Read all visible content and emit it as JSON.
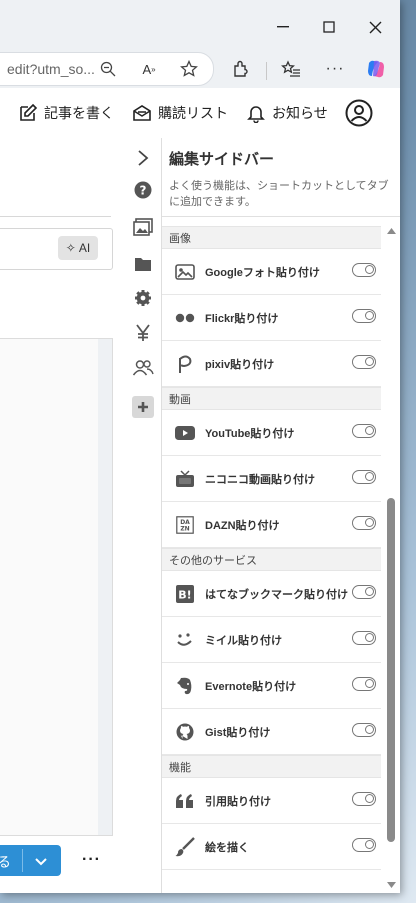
{
  "browser": {
    "address_text": "edit?utm_so...",
    "minimize": "—",
    "maximize": "☐",
    "close": "✕"
  },
  "toolbar": {
    "write_label": "記事を書く",
    "reading_label": "購読リスト",
    "notify_label": "お知らせ"
  },
  "editor": {
    "ai_label": "AI",
    "publish_fragment": "る"
  },
  "sidebar": {
    "title": "編集サイドバー",
    "description": "よく使う機能は、ショートカットとしてタブに追加できます。",
    "sections": [
      {
        "name": "画像",
        "items": [
          {
            "label": "Googleフォト貼り付け",
            "icon": "google-photos-icon"
          },
          {
            "label": "Flickr貼り付け",
            "icon": "flickr-icon"
          },
          {
            "label": "pixiv貼り付け",
            "icon": "pixiv-icon"
          }
        ]
      },
      {
        "name": "動画",
        "items": [
          {
            "label": "YouTube貼り付け",
            "icon": "youtube-icon"
          },
          {
            "label": "ニコニコ動画貼り付け",
            "icon": "niconico-icon"
          },
          {
            "label": "DAZN貼り付け",
            "icon": "dazn-icon"
          }
        ]
      },
      {
        "name": "その他のサービス",
        "items": [
          {
            "label": "はてなブックマーク貼り付け",
            "icon": "hatena-bookmark-icon"
          },
          {
            "label": "ミイル貼り付け",
            "icon": "miil-icon"
          },
          {
            "label": "Evernote貼り付け",
            "icon": "evernote-icon"
          },
          {
            "label": "Gist貼り付け",
            "icon": "github-icon"
          }
        ]
      },
      {
        "name": "機能",
        "items": [
          {
            "label": "引用貼り付け",
            "icon": "quote-icon"
          },
          {
            "label": "絵を描く",
            "icon": "brush-icon"
          }
        ]
      }
    ]
  },
  "colors": {
    "accent_blue": "#2d8fd5",
    "copilot": "#7b5cf0"
  }
}
